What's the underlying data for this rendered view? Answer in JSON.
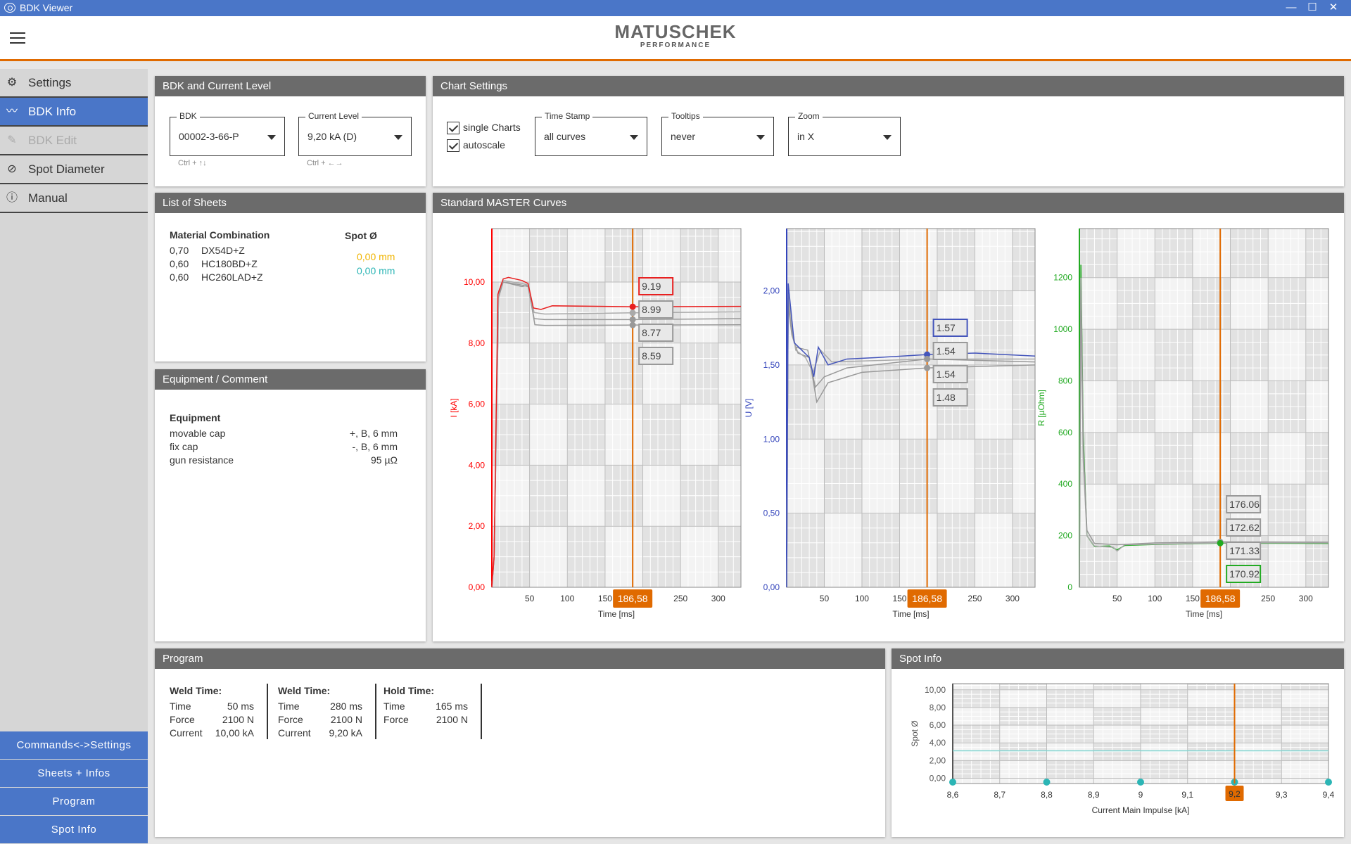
{
  "window": {
    "title": "BDK Viewer",
    "minimize": "—",
    "maximize": "☐",
    "close": "✕"
  },
  "logo": {
    "main": "MATUSCHEK",
    "sub": "PERFORMANCE"
  },
  "sidebar": {
    "items": [
      {
        "label": "Settings",
        "icon": "gear-icon",
        "glyph": "⚙",
        "state": "normal"
      },
      {
        "label": "BDK Info",
        "icon": "chart-line-icon",
        "glyph": "〰",
        "state": "active"
      },
      {
        "label": "BDK Edit",
        "icon": "pencil-icon",
        "glyph": "✎",
        "state": "disabled"
      },
      {
        "label": "Spot Diameter",
        "icon": "diameter-icon",
        "glyph": "⊘",
        "state": "normal"
      },
      {
        "label": "Manual",
        "icon": "info-icon",
        "glyph": "ⓘ",
        "state": "normal"
      }
    ],
    "bottom_buttons": [
      "Commands<->Settings",
      "Sheets + Infos",
      "Program",
      "Spot Info"
    ]
  },
  "bdk_panel": {
    "title": "BDK and Current Level",
    "bdk_label": "BDK",
    "bdk_value": "00002-3-66-P",
    "bdk_hint": "Ctrl + ↑↓",
    "level_label": "Current Level",
    "level_value": "9,20 kA (D)",
    "level_hint": "Ctrl + ←→"
  },
  "chart_settings": {
    "title": "Chart Settings",
    "single_charts": "single Charts",
    "single_checked": true,
    "autoscale": "autoscale",
    "autoscale_checked": true,
    "time_stamp_label": "Time Stamp",
    "time_stamp_value": "all curves",
    "tooltips_label": "Tooltips",
    "tooltips_value": "never",
    "zoom_label": "Zoom",
    "zoom_value": "in X"
  },
  "sheets": {
    "title": "List of Sheets",
    "col1": "Material Combination",
    "col2": "Spot Ø",
    "rows": [
      {
        "thick": "0,70",
        "mat": "DX54D+Z"
      },
      {
        "thick": "0,60",
        "mat": "HC180BD+Z"
      },
      {
        "thick": "0,60",
        "mat": "HC260LAD+Z"
      }
    ],
    "spots": [
      {
        "v": "0,00 mm",
        "color": "#f0b400"
      },
      {
        "v": "0,00 mm",
        "color": "#2bb5b5"
      }
    ]
  },
  "equipment": {
    "title": "Equipment / Comment",
    "heading": "Equipment",
    "rows": [
      {
        "k": "movable cap",
        "v": "+, B, 6 mm"
      },
      {
        "k": "fix cap",
        "v": "-, B, 6 mm"
      },
      {
        "k": "gun resistance",
        "v": "95 µΩ"
      }
    ]
  },
  "curves_panel": {
    "title": "Standard MASTER Curves"
  },
  "program": {
    "title": "Program",
    "blocks": [
      {
        "title": "Weld Time:",
        "rows": [
          [
            "Time",
            "50 ms"
          ],
          [
            "Force",
            "2100 N"
          ],
          [
            "Current",
            "10,00 kA"
          ]
        ]
      },
      {
        "title": "Weld Time:",
        "rows": [
          [
            "Time",
            "280 ms"
          ],
          [
            "Force",
            "2100 N"
          ],
          [
            "Current",
            "9,20 kA"
          ]
        ]
      },
      {
        "title": "Hold Time:",
        "rows": [
          [
            "Time",
            "165 ms"
          ],
          [
            "Force",
            "2100 N"
          ]
        ]
      }
    ]
  },
  "spot_info": {
    "title": "Spot Info"
  },
  "chart_data": [
    {
      "type": "line",
      "ylabel": "I [kA]",
      "xlabel": "Time [ms]",
      "xlim": [
        0,
        330
      ],
      "ylim": [
        0,
        11.75
      ],
      "xticks": [
        50,
        100,
        150,
        250,
        300
      ],
      "yticks": [
        0,
        2,
        4,
        6,
        8,
        10
      ],
      "ydec": 2,
      "axis_color": "#ff0000",
      "cursor": "186,58",
      "cursor_x": 186.58,
      "series": [
        {
          "color": "#e82020",
          "points": [
            [
              0,
              0
            ],
            [
              3,
              1
            ],
            [
              8,
              9.6
            ],
            [
              15,
              10.1
            ],
            [
              22,
              10.15
            ],
            [
              40,
              10.05
            ],
            [
              48,
              9.95
            ],
            [
              55,
              9.15
            ],
            [
              65,
              9.1
            ],
            [
              80,
              9.22
            ],
            [
              186.58,
              9.19
            ],
            [
              330,
              9.2
            ]
          ]
        },
        {
          "color": "#aaaaaa",
          "points": [
            [
              0,
              0
            ],
            [
              3,
              1
            ],
            [
              9,
              9.7
            ],
            [
              15,
              10.05
            ],
            [
              40,
              9.95
            ],
            [
              48,
              9.9
            ],
            [
              56,
              9.0
            ],
            [
              70,
              8.95
            ],
            [
              186.58,
              8.99
            ],
            [
              330,
              9.02
            ]
          ]
        },
        {
          "color": "#999999",
          "points": [
            [
              0,
              0
            ],
            [
              3,
              1
            ],
            [
              9,
              9.6
            ],
            [
              15,
              10.0
            ],
            [
              40,
              9.9
            ],
            [
              48,
              9.85
            ],
            [
              56,
              8.8
            ],
            [
              70,
              8.77
            ],
            [
              186.58,
              8.77
            ],
            [
              330,
              8.8
            ]
          ]
        },
        {
          "color": "#999999",
          "points": [
            [
              0,
              0
            ],
            [
              3,
              1
            ],
            [
              9,
              9.5
            ],
            [
              15,
              10.0
            ],
            [
              40,
              9.85
            ],
            [
              48,
              9.9
            ],
            [
              57,
              8.6
            ],
            [
              70,
              8.58
            ],
            [
              186.58,
              8.59
            ],
            [
              330,
              8.6
            ]
          ]
        }
      ],
      "tooltips": [
        {
          "v": "9.19",
          "border": "#e82020"
        },
        {
          "v": "8.99",
          "border": "#999999"
        },
        {
          "v": "8.77",
          "border": "#999999"
        },
        {
          "v": "8.59",
          "border": "#999999"
        }
      ]
    },
    {
      "type": "line",
      "ylabel": "U [V]",
      "xlabel": "Time [ms]",
      "xlim": [
        0,
        330
      ],
      "ylim": [
        0,
        2.42
      ],
      "xticks": [
        50,
        100,
        150,
        250,
        300
      ],
      "yticks": [
        0,
        0.5,
        1,
        1.5,
        2
      ],
      "ydec": 2,
      "axis_color": "#3344bb",
      "cursor": "186,58",
      "cursor_x": 186.58,
      "series": [
        {
          "color": "#4455bb",
          "points": [
            [
              0,
              0
            ],
            [
              2,
              2.05
            ],
            [
              5,
              1.9
            ],
            [
              10,
              1.65
            ],
            [
              20,
              1.6
            ],
            [
              30,
              1.55
            ],
            [
              36,
              1.42
            ],
            [
              42,
              1.62
            ],
            [
              55,
              1.5
            ],
            [
              80,
              1.54
            ],
            [
              120,
              1.55
            ],
            [
              186.58,
              1.57
            ],
            [
              250,
              1.58
            ],
            [
              330,
              1.56
            ]
          ]
        },
        {
          "color": "#aaaaaa",
          "points": [
            [
              0,
              0
            ],
            [
              2,
              2.0
            ],
            [
              6,
              1.8
            ],
            [
              12,
              1.6
            ],
            [
              25,
              1.55
            ],
            [
              35,
              1.45
            ],
            [
              45,
              1.6
            ],
            [
              60,
              1.52
            ],
            [
              186.58,
              1.54
            ],
            [
              330,
              1.54
            ]
          ]
        },
        {
          "color": "#999999",
          "points": [
            [
              0,
              0
            ],
            [
              2,
              1.95
            ],
            [
              6,
              1.75
            ],
            [
              12,
              1.62
            ],
            [
              28,
              1.6
            ],
            [
              38,
              1.35
            ],
            [
              50,
              1.42
            ],
            [
              80,
              1.48
            ],
            [
              186.58,
              1.54
            ],
            [
              330,
              1.52
            ]
          ]
        },
        {
          "color": "#999999",
          "points": [
            [
              0,
              0
            ],
            [
              2,
              1.9
            ],
            [
              7,
              1.7
            ],
            [
              15,
              1.58
            ],
            [
              30,
              1.55
            ],
            [
              40,
              1.25
            ],
            [
              55,
              1.38
            ],
            [
              100,
              1.45
            ],
            [
              186.58,
              1.48
            ],
            [
              330,
              1.5
            ]
          ]
        }
      ],
      "tooltips": [
        {
          "v": "1.57",
          "border": "#4455bb"
        },
        {
          "v": "1.54",
          "border": "#999999"
        },
        {
          "v": "1.54",
          "border": "#999999"
        },
        {
          "v": "1.48",
          "border": "#999999"
        }
      ]
    },
    {
      "type": "line",
      "ylabel": "R [µOhm]",
      "xlabel": "Time [ms]",
      "xlim": [
        0,
        330
      ],
      "ylim": [
        0,
        1390
      ],
      "xticks": [
        50,
        100,
        150,
        250,
        300
      ],
      "yticks": [
        0,
        200,
        400,
        600,
        800,
        1000,
        1200
      ],
      "ydec": 0,
      "axis_color": "#22aa22",
      "cursor": "186,58",
      "cursor_x": 186.58,
      "series": [
        {
          "color": "#999999",
          "points": [
            [
              0,
              0
            ],
            [
              2,
              1200
            ],
            [
              5,
              550
            ],
            [
              10,
              220
            ],
            [
              20,
              170
            ],
            [
              50,
              165
            ],
            [
              100,
              172
            ],
            [
              186.58,
              176
            ],
            [
              330,
              175
            ]
          ]
        },
        {
          "color": "#aaaaaa",
          "points": [
            [
              0,
              0
            ],
            [
              2,
              1150
            ],
            [
              5,
              500
            ],
            [
              10,
              200
            ],
            [
              20,
              160
            ],
            [
              45,
              155
            ],
            [
              50,
              140
            ],
            [
              60,
              165
            ],
            [
              186.58,
              172
            ],
            [
              330,
              172
            ]
          ]
        },
        {
          "color": "#22aa22",
          "points": [
            [
              0,
              0
            ],
            [
              2,
              1250
            ],
            [
              5,
              600
            ],
            [
              10,
              200
            ],
            [
              20,
              158
            ],
            [
              40,
              160
            ],
            [
              50,
              145
            ],
            [
              60,
              162
            ],
            [
              100,
              166
            ],
            [
              186.58,
              170.92
            ],
            [
              330,
              170
            ]
          ]
        }
      ],
      "tooltips": [
        {
          "v": "176.06",
          "border": "#999999"
        },
        {
          "v": "172.62",
          "border": "#999999"
        },
        {
          "v": "171.33",
          "border": "#999999"
        },
        {
          "v": "170.92",
          "border": "#22aa22"
        }
      ]
    },
    {
      "type": "line",
      "ylabel": "Spot Ø",
      "xlabel": "Current Main Impulse [kA]",
      "xlim": [
        8.6,
        9.4
      ],
      "ylim": [
        -0.6,
        10.7
      ],
      "xticks": [
        8.6,
        8.7,
        8.8,
        8.9,
        9,
        9.1,
        9.2,
        9.3,
        9.4
      ],
      "xtick_labels": [
        "8,6",
        "8,7",
        "8,8",
        "8,9",
        "9",
        "9,1",
        "9,2",
        "9,3",
        "9,4"
      ],
      "yticks": [
        0,
        2,
        4,
        6,
        8,
        10
      ],
      "ydec": 2,
      "axis_color": "#555555",
      "cursor": "9,2",
      "cursor_x": 9.2,
      "series": [
        {
          "color": "#7fd4d0",
          "points": [
            [
              8.6,
              3.1
            ],
            [
              9.4,
              3.1
            ]
          ]
        }
      ],
      "points": {
        "color": "#2bb5b5",
        "x": [
          8.6,
          8.8,
          9.0,
          9.2,
          9.4
        ],
        "y": [
          -0.6,
          -0.6,
          -0.6,
          -0.6,
          -0.6
        ]
      }
    }
  ]
}
